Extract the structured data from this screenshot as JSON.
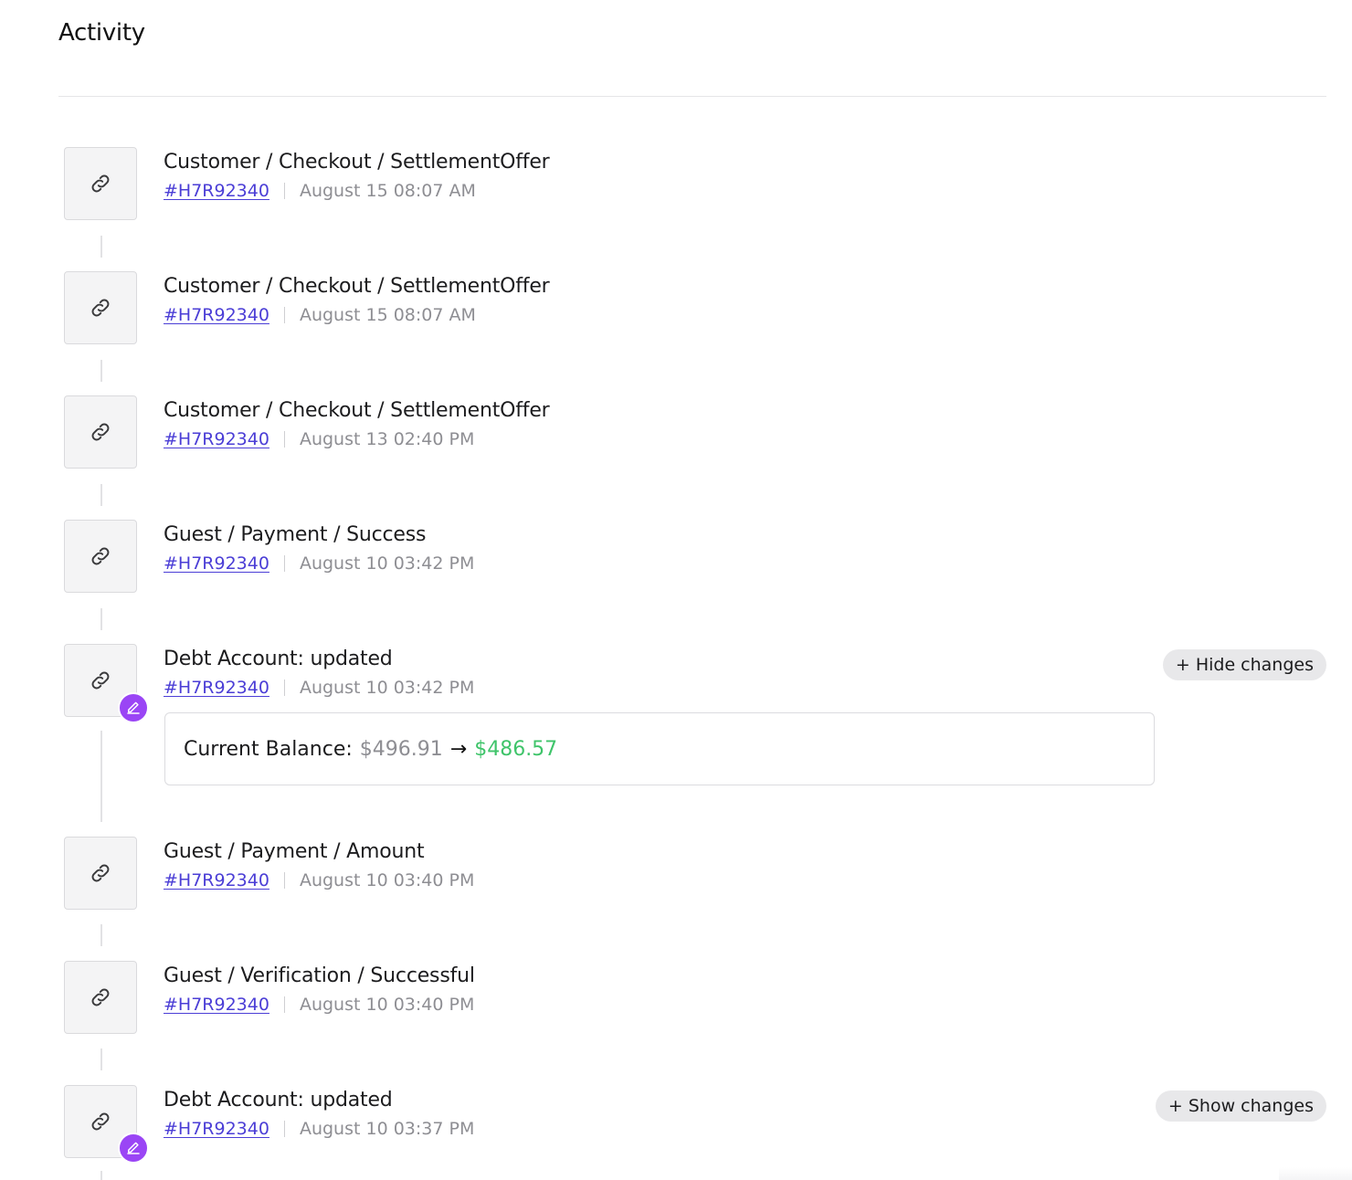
{
  "page": {
    "title": "Activity"
  },
  "activity": [
    {
      "title": "Customer / Checkout / SettlementOffer",
      "ref": "#H7R92340",
      "timestamp": "August 15 08:07 AM",
      "icon": "link-icon",
      "edited": false
    },
    {
      "title": "Customer / Checkout / SettlementOffer",
      "ref": "#H7R92340",
      "timestamp": "August 15 08:07 AM",
      "icon": "link-icon",
      "edited": false
    },
    {
      "title": "Customer / Checkout / SettlementOffer",
      "ref": "#H7R92340",
      "timestamp": "August 13 02:40 PM",
      "icon": "link-icon",
      "edited": false
    },
    {
      "title": "Guest / Payment / Success",
      "ref": "#H7R92340",
      "timestamp": "August 10 03:42 PM",
      "icon": "link-icon",
      "edited": false
    },
    {
      "title": "Debt Account: updated",
      "ref": "#H7R92340",
      "timestamp": "August 10 03:42 PM",
      "icon": "link-icon",
      "edited": true,
      "toggle_label": "+ Hide changes",
      "changes": {
        "label": "Current Balance:",
        "old_value": "$496.91",
        "arrow": "→",
        "new_value": "$486.57"
      }
    },
    {
      "title": "Guest / Payment / Amount",
      "ref": "#H7R92340",
      "timestamp": "August 10 03:40 PM",
      "icon": "link-icon",
      "edited": false
    },
    {
      "title": "Guest / Verification / Successful",
      "ref": "#H7R92340",
      "timestamp": "August 10 03:40 PM",
      "icon": "link-icon",
      "edited": false
    },
    {
      "title": "Debt Account: updated",
      "ref": "#H7R92340",
      "timestamp": "August 10 03:37 PM",
      "icon": "link-icon",
      "edited": true,
      "toggle_label": "+ Show changes"
    }
  ],
  "colors": {
    "link": "#4b3ed6",
    "timestamp": "#8e8e93",
    "badge": "#9a45f5",
    "new_value": "#3fc46a"
  }
}
